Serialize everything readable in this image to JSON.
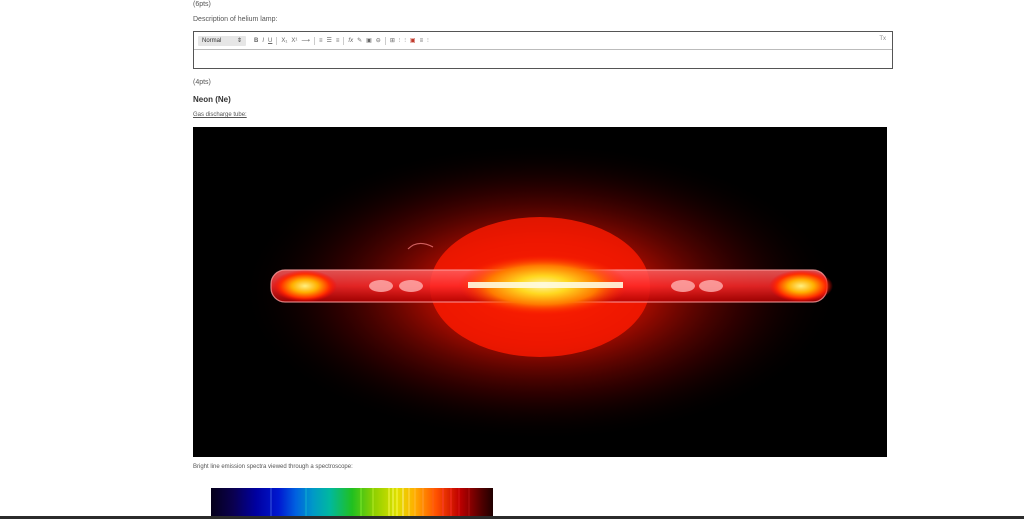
{
  "sections": {
    "helium": {
      "points": "(6pts)",
      "description_label": "Description of helium lamp:"
    },
    "neon": {
      "points": "(4pts)",
      "title": "Neon (Ne)",
      "tube_label": "Gas discharge tube:",
      "spectra_label": "Bright line emission spectra viewed through a spectroscope:"
    }
  },
  "editor": {
    "style_select": "Normal",
    "buttons": {
      "bold": "B",
      "italic": "I",
      "underline": "U",
      "subscript": "X₁",
      "superscript": "X¹",
      "arrow": "⟶",
      "ordered_list": "≡",
      "unordered_list": "☰",
      "align": "≡",
      "formula": "fx",
      "link": "✎",
      "image": "▣",
      "chain": "⊖",
      "table": "⊞",
      "t1": "⫶",
      "t2": "⫶",
      "t3": "▣",
      "t4": "≡",
      "t5": "⫶",
      "clear_format": "Tx"
    },
    "content": ""
  },
  "colors": {
    "tube_glow": "#ff2a00",
    "tube_core": "#ffe040",
    "background": "#000000"
  }
}
